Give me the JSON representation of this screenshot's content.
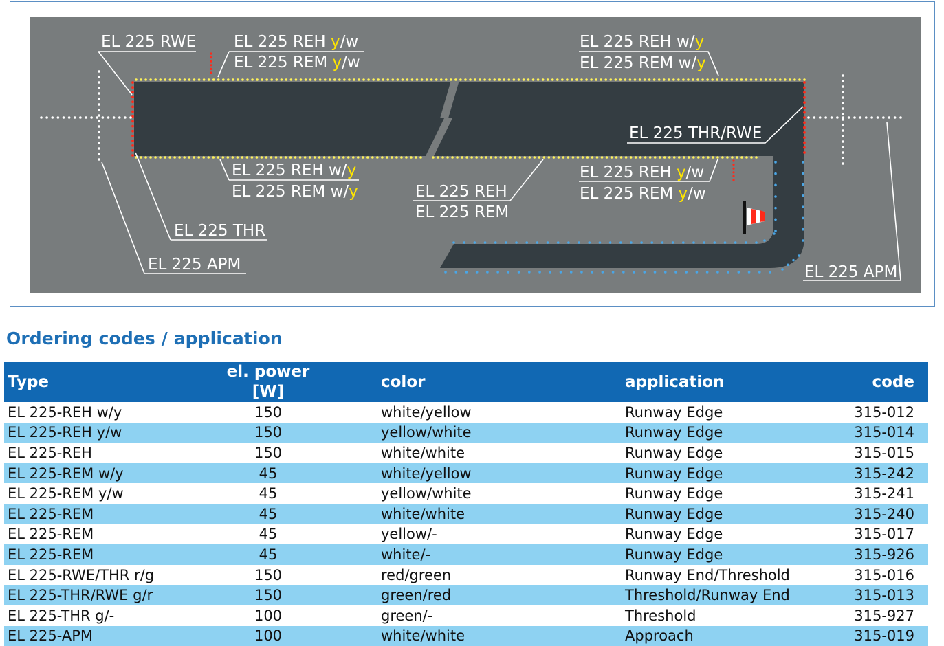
{
  "diagram": {
    "labels": {
      "rwe_left": "EL 225 RWE",
      "reh_top_left": [
        "EL 225 REH ",
        "y",
        "/w"
      ],
      "rem_top_left": [
        "EL 225 REM ",
        "y",
        "/w"
      ],
      "reh_top_right": [
        "EL 225 REH w/",
        "y",
        ""
      ],
      "rem_top_right": [
        "EL 225 REM w/",
        "y",
        ""
      ],
      "thr_rwe": "EL 225 THR/RWE",
      "reh_bottom_left": [
        "EL 225 REH w/",
        "y",
        ""
      ],
      "rem_bottom_left": [
        "EL 225 REM w/",
        "y",
        ""
      ],
      "reh_mid": "EL 225 REH",
      "rem_mid": "EL 225 REM",
      "reh_bottom_right": [
        "EL 225 REH ",
        "y",
        "/w"
      ],
      "rem_bottom_right": [
        "EL 225 REM ",
        "y",
        "/w"
      ],
      "thr": "EL 225 THR",
      "apm_left": "EL 225 APM",
      "apm_right": "EL 225 APM"
    },
    "colors": {
      "background": "#787c7d",
      "pavement": "#343d42",
      "edge_light": "#fff35a",
      "threshold_red": "#ff2a1a",
      "taxi_blue": "#4aa6e6",
      "highlight": "#ffe600"
    }
  },
  "section_title": "Ordering codes / application",
  "table": {
    "headers": [
      "Type",
      "el. power [W]",
      "color",
      "application",
      "code"
    ],
    "rows": [
      [
        "EL 225-REH w/y",
        "150",
        "white/yellow",
        "Runway Edge",
        "315-012"
      ],
      [
        "EL 225-REH y/w",
        "150",
        "yellow/white",
        "Runway Edge",
        "315-014"
      ],
      [
        "EL 225-REH",
        "150",
        "white/white",
        "Runway Edge",
        "315-015"
      ],
      [
        "EL 225-REM w/y",
        "45",
        "white/yellow",
        "Runway Edge",
        "315-242"
      ],
      [
        "EL 225-REM y/w",
        "45",
        "yellow/white",
        "Runway Edge",
        "315-241"
      ],
      [
        "EL 225-REM",
        "45",
        "white/white",
        "Runway Edge",
        "315-240"
      ],
      [
        "EL 225-REM",
        "45",
        "yellow/-",
        "Runway Edge",
        "315-017"
      ],
      [
        "EL 225-REM",
        "45",
        "white/-",
        "Runway Edge",
        "315-926"
      ],
      [
        "EL 225-RWE/THR r/g",
        "150",
        "red/green",
        "Runway End/Threshold",
        "315-016"
      ],
      [
        "EL 225-THR/RWE g/r",
        "150",
        "green/red",
        "Threshold/Runway End",
        "315-013"
      ],
      [
        "EL 225-THR g/-",
        "100",
        "green/-",
        "Threshold",
        "315-927"
      ],
      [
        "EL 225-APM",
        "100",
        "white/white",
        "Approach",
        "315-019"
      ]
    ]
  }
}
